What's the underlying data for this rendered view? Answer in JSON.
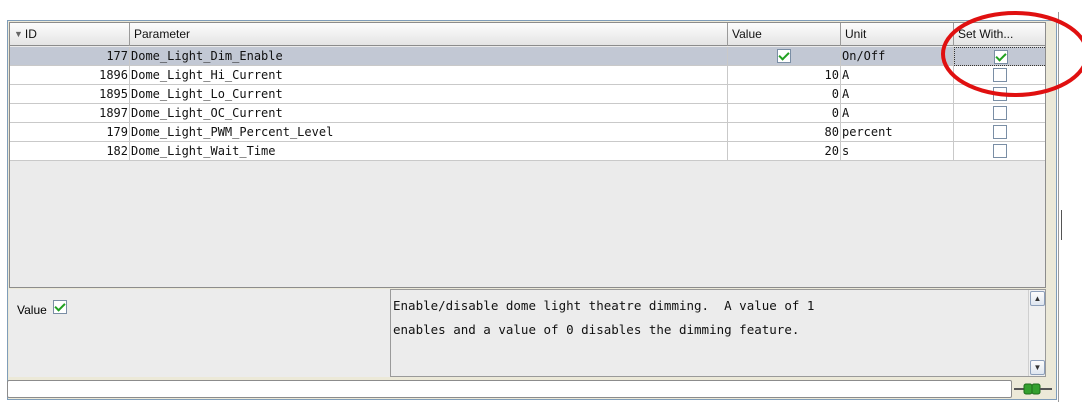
{
  "table": {
    "columns": {
      "id": "ID",
      "parameter": "Parameter",
      "value": "Value",
      "unit": "Unit",
      "set_with": "Set With..."
    },
    "rows": [
      {
        "id": "177",
        "parameter": "Dome_Light_Dim_Enable",
        "value": "",
        "value_is_checkbox": true,
        "value_checked": true,
        "unit": "On/Off",
        "set_with_checked": true,
        "selected": true
      },
      {
        "id": "1896",
        "parameter": "Dome_Light_Hi_Current",
        "value": "10",
        "unit": "A",
        "set_with_checked": false
      },
      {
        "id": "1895",
        "parameter": "Dome_Light_Lo_Current",
        "value": "0",
        "unit": "A",
        "set_with_checked": false
      },
      {
        "id": "1897",
        "parameter": "Dome_Light_OC_Current",
        "value": "0",
        "unit": "A",
        "set_with_checked": false
      },
      {
        "id": "179",
        "parameter": "Dome_Light_PWM_Percent_Level",
        "value": "80",
        "unit": "percent",
        "set_with_checked": false
      },
      {
        "id": "182",
        "parameter": "Dome_Light_Wait_Time",
        "value": "20",
        "unit": "s",
        "set_with_checked": false
      }
    ]
  },
  "editor": {
    "value_label": "Value",
    "value_checked": true,
    "description": "Enable/disable dome light theatre dimming.  A value of 1\nenables and a value of 0 disables the dimming feature."
  },
  "status_input": {
    "value": ""
  },
  "icons": {
    "filter": "filter-icon",
    "connection": "plug-connected-icon",
    "scroll_up": "chevron-up-icon",
    "scroll_down": "chevron-down-icon"
  },
  "colors": {
    "checkmark": "#21a121",
    "selected_row": "#c2c8d4",
    "annotation_circle": "#e01010",
    "plug_green": "#34a02f"
  }
}
